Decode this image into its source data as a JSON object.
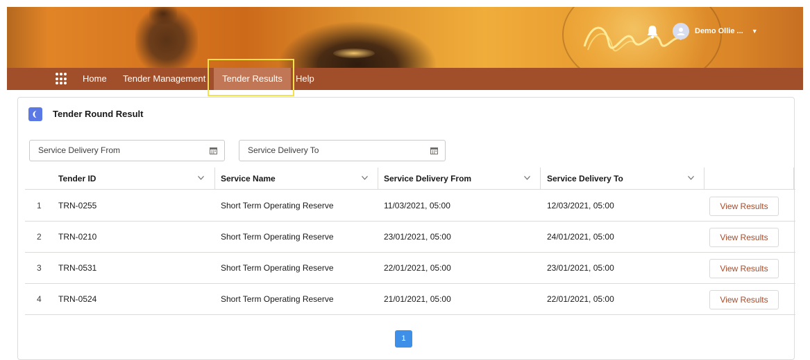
{
  "header": {
    "user_name": "Demo Ollie ...",
    "icons": {
      "bell": "bell-icon",
      "avatar": "user-avatar-icon",
      "caret": "caret-down-icon"
    }
  },
  "nav": {
    "items": [
      {
        "label": "Home"
      },
      {
        "label": "Tender Management"
      },
      {
        "label": "Tender Results",
        "active": true
      },
      {
        "label": "Help"
      }
    ],
    "colors": {
      "bar": "#a14f2a",
      "active": "#c17656",
      "highlight": "#f4e24a"
    }
  },
  "card": {
    "title": "Tender Round Result",
    "filters": {
      "from_placeholder": "Service Delivery From",
      "to_placeholder": "Service Delivery To"
    },
    "table": {
      "columns": [
        "Tender ID",
        "Service Name",
        "Service Delivery From",
        "Service Delivery To"
      ],
      "rows": [
        {
          "num": "1",
          "id": "TRN-0255",
          "service": "Short Term Operating Reserve",
          "from": "11/03/2021, 05:00",
          "to": "12/03/2021, 05:00",
          "action": "View Results"
        },
        {
          "num": "2",
          "id": "TRN-0210",
          "service": "Short Term Operating Reserve",
          "from": "23/01/2021, 05:00",
          "to": "24/01/2021, 05:00",
          "action": "View Results"
        },
        {
          "num": "3",
          "id": "TRN-0531",
          "service": "Short Term Operating Reserve",
          "from": "22/01/2021, 05:00",
          "to": "23/01/2021, 05:00",
          "action": "View Results"
        },
        {
          "num": "4",
          "id": "TRN-0524",
          "service": "Short Term Operating Reserve",
          "from": "21/01/2021, 05:00",
          "to": "22/01/2021, 05:00",
          "action": "View Results"
        }
      ]
    },
    "pagination": {
      "current": "1"
    }
  }
}
